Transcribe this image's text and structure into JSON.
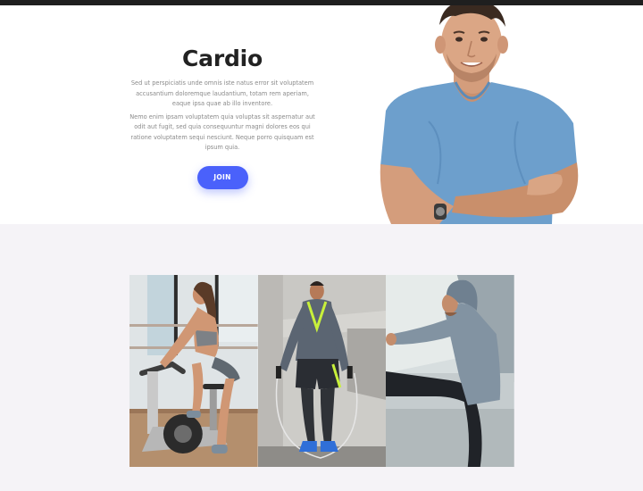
{
  "hero": {
    "title": "Cardio",
    "paragraph1": "Sed ut perspiciatis unde omnis iste natus error sit voluptatem accusantium doloremque laudantium, totam rem aperiam, eaque ipsa quae ab illo inventore.",
    "paragraph2": "Nemo enim ipsam voluptatem quia voluptas sit aspernatur aut odit aut fugit, sed quia consequuntur magni dolores eos qui ratione voluptatem sequi nesciunt. Neque porro quisquam est ipsum quia.",
    "join_label": "JOIN"
  },
  "colors": {
    "accent": "#4a61fb",
    "top_bar": "#1f1f1f",
    "section_bg": "#f5f3f7"
  },
  "gallery": {
    "photos": [
      "cycling-woman-photo",
      "jump-rope-man-photo",
      "stretching-man-photo"
    ]
  }
}
